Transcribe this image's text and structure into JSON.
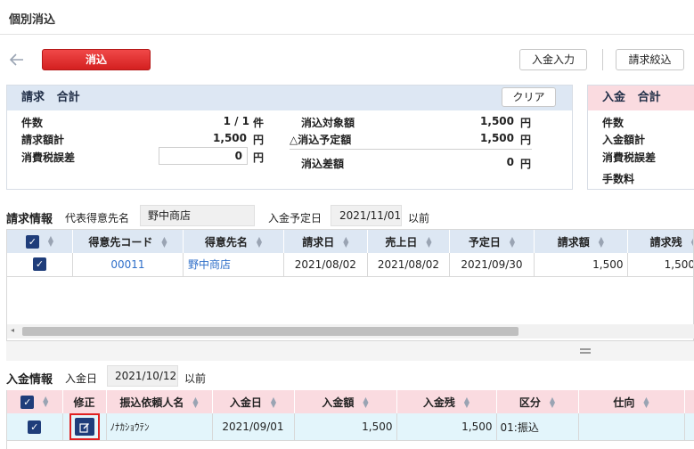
{
  "page": {
    "title": "個別消込"
  },
  "toolbar": {
    "apply_label": "消込",
    "deposit_input_label": "入金入力",
    "invoice_filter_label": "請求絞込"
  },
  "invoice_total": {
    "heading_left": "請求",
    "heading_right": "合計",
    "clear_label": "クリア",
    "count_label": "件数",
    "count_value": "1 / 1",
    "count_unit": "件",
    "amount_label": "請求額計",
    "amount_value": "1,500",
    "amount_unit": "円",
    "tax_label": "消費税誤差",
    "tax_value": "0",
    "tax_unit": "円",
    "target_label": "消込対象額",
    "target_value": "1,500",
    "target_unit": "円",
    "planned_label": "△消込予定額",
    "planned_value": "1,500",
    "planned_unit": "円",
    "diff_label": "消込差額",
    "diff_value": "0",
    "diff_unit": "円"
  },
  "deposit_total": {
    "heading_left": "入金",
    "heading_right": "合計",
    "count_label": "件数",
    "amount_label": "入金額計",
    "tax_label": "消費税誤差",
    "fee_label": "手数料"
  },
  "invoice_info": {
    "section_label": "請求情報",
    "customer_label": "代表得意先名",
    "customer_value": "野中商店",
    "due_label": "入金予定日",
    "due_value": "2021/11/01",
    "due_suffix": "以前",
    "columns": [
      "得意先コード",
      "得意先名",
      "請求日",
      "売上日",
      "予定日",
      "請求額",
      "請求残"
    ],
    "rows": [
      {
        "code": "00011",
        "name": "野中商店",
        "invoice_date": "2021/08/02",
        "sales_date": "2021/08/02",
        "due_date": "2021/09/30",
        "amount": "1,500",
        "remaining": "1,500"
      }
    ]
  },
  "deposit_info": {
    "section_label": "入金情報",
    "date_label": "入金日",
    "date_value": "2021/10/12",
    "date_suffix": "以前",
    "columns": [
      "修正",
      "振込依頼人名",
      "入金日",
      "入金額",
      "入金残",
      "区分",
      "仕向"
    ],
    "rows": [
      {
        "requester": "ﾉﾅｶｼｮｳﾃﾝ",
        "date": "2021/09/01",
        "amount": "1,500",
        "remaining": "1,500",
        "category": "01:振込",
        "destination": ""
      }
    ]
  },
  "colors": {
    "accent_red": "#e02b2b",
    "header_blue": "#dde7f3",
    "header_pink": "#fadbe0",
    "check_navy": "#1f3d7a",
    "link_blue": "#2f6fc9"
  },
  "icons": {
    "back": "arrow-left-icon",
    "edit": "edit-icon",
    "check": "checkbox-checked-icon",
    "sort": "sort-icon"
  }
}
